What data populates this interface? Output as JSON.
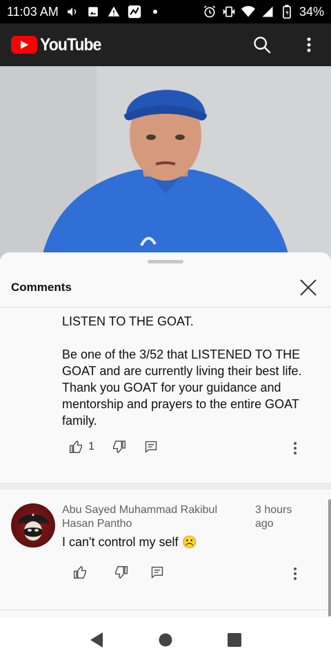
{
  "status_bar": {
    "time": "11:03 AM",
    "battery": "34%",
    "left_icons": [
      "volume-icon",
      "image-icon",
      "warning-icon",
      "app-notification-icon",
      "dot-icon"
    ],
    "right_icons": [
      "alarm-icon",
      "vibrate-icon",
      "wifi-icon",
      "signal-icon",
      "battery-icon"
    ]
  },
  "app_bar": {
    "brand": "YouTube",
    "actions": [
      "search-icon",
      "more-vert-icon"
    ]
  },
  "comments_sheet": {
    "title": "Comments",
    "comment_1": {
      "lines": [
        "LISTEN TO THE GOAT.",
        "Be one of the 3/52 that LISTENED TO THE GOAT and are currently living their best life. Thank you GOAT for your guidance and mentorship and prayers to the entire GOAT family."
      ],
      "likes": "1"
    },
    "comment_2": {
      "author": "Abu Sayed Muhammad Rakibul Hasan Pantho",
      "time_ago": "3 hours ago",
      "text": "I can't control my self ☹️",
      "likes": ""
    }
  },
  "colors": {
    "brand_red": "#ff0000",
    "app_bar_bg": "#212121",
    "text_primary": "#0f0f0f",
    "text_secondary": "#606060"
  },
  "nav_bar": [
    "back-icon",
    "home-icon",
    "recents-icon"
  ]
}
